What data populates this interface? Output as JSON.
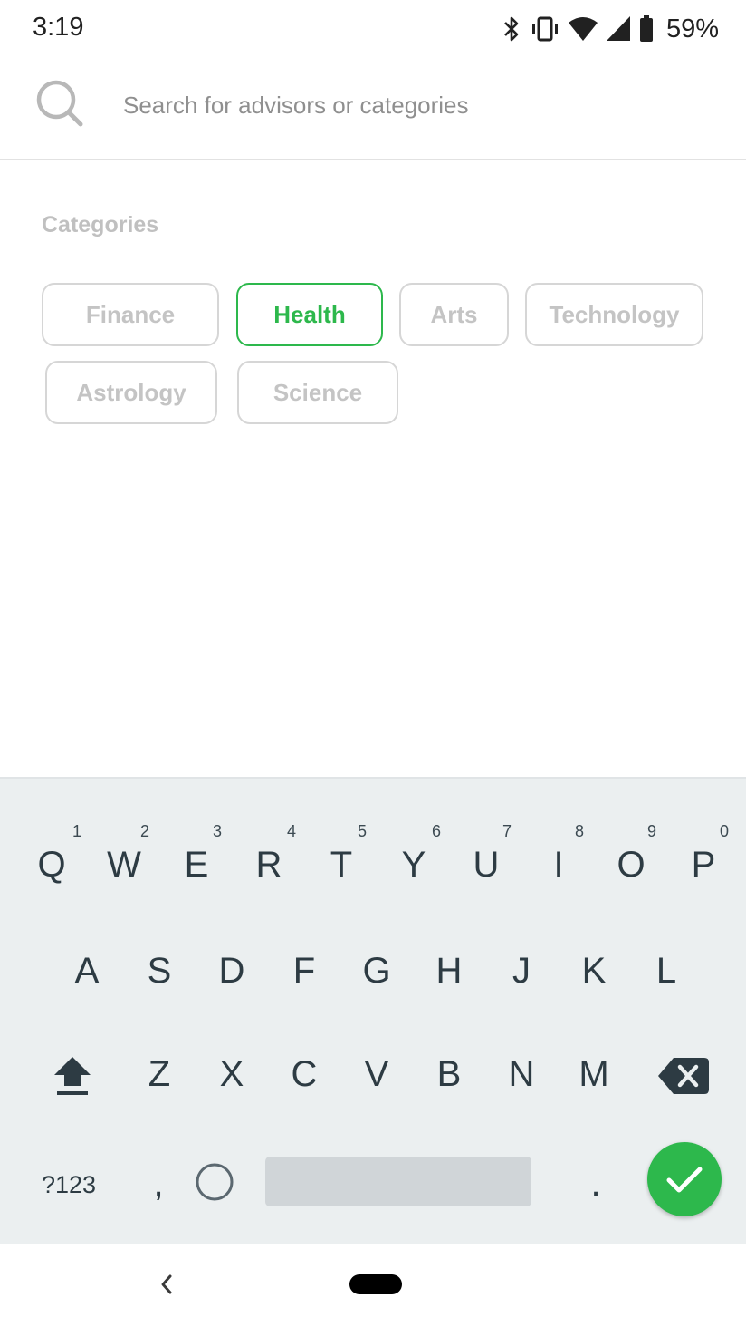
{
  "status_bar": {
    "time": "3:19",
    "battery": "59%",
    "icons": [
      "bluetooth-icon",
      "vibrate-icon",
      "wifi-icon",
      "cell-signal-icon",
      "battery-icon"
    ]
  },
  "search": {
    "placeholder": "Search for advisors or categories",
    "value": ""
  },
  "categories": {
    "heading": "Categories",
    "items": [
      {
        "label": "Finance",
        "selected": false
      },
      {
        "label": "Health",
        "selected": true
      },
      {
        "label": "Arts",
        "selected": false
      },
      {
        "label": "Technology",
        "selected": false
      },
      {
        "label": "Astrology",
        "selected": false
      },
      {
        "label": "Science",
        "selected": false
      }
    ],
    "selected_color": "#2db84c"
  },
  "keyboard": {
    "row1": [
      "Q",
      "W",
      "E",
      "R",
      "T",
      "Y",
      "U",
      "I",
      "O",
      "P"
    ],
    "row1_hints": [
      "1",
      "2",
      "3",
      "4",
      "5",
      "6",
      "7",
      "8",
      "9",
      "0"
    ],
    "row2": [
      "A",
      "S",
      "D",
      "F",
      "G",
      "H",
      "J",
      "K",
      "L"
    ],
    "row3": [
      "Z",
      "X",
      "C",
      "V",
      "B",
      "N",
      "M"
    ],
    "symbols_label": "?123",
    "comma": ",",
    "period": ".",
    "accent_color": "#2db84c"
  }
}
